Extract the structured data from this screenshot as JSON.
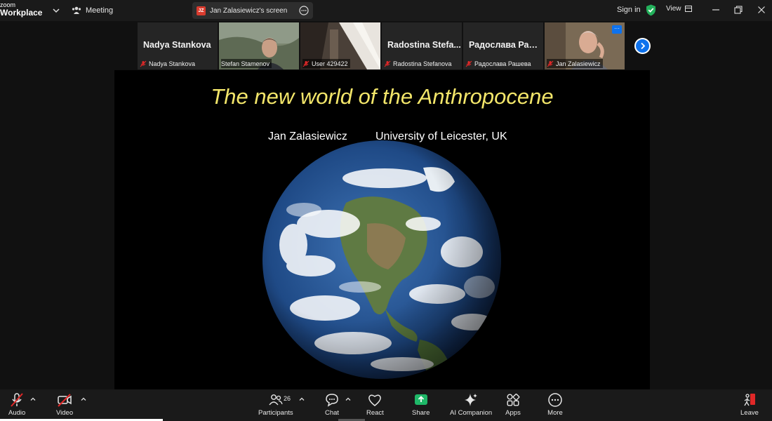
{
  "app": {
    "logo_line1": "zoom",
    "logo_line2": "Workplace",
    "meeting_label": "Meeting"
  },
  "share_pill": {
    "badge": "JZ",
    "label": "Jan Zalasiewicz's screen"
  },
  "top_right": {
    "sign_in": "Sign in",
    "view": "View"
  },
  "thumbnails": [
    {
      "big_name": "Nadya Stankova",
      "label": "Nadya Stankova",
      "muted": true,
      "video": false
    },
    {
      "big_name": "",
      "label": "Stefan Stamenov",
      "muted": false,
      "video": true,
      "active": true
    },
    {
      "big_name": "",
      "label": "User 429422",
      "muted": true,
      "video": true
    },
    {
      "big_name": "Radostina Stefa...",
      "label": "Radostina Stefanova",
      "muted": true,
      "video": false
    },
    {
      "big_name": "Радослава Раш...",
      "label": "Радослава Рашева",
      "muted": true,
      "video": false
    },
    {
      "big_name": "",
      "label": "Jan Zalasiewicz",
      "muted": true,
      "video": true
    }
  ],
  "slide": {
    "title": "The new world of the Anthropocene",
    "author": "Jan Zalasiewicz",
    "affiliation": "University of Leicester, UK"
  },
  "toolbar": {
    "audio": "Audio",
    "video": "Video",
    "participants": "Participants",
    "participants_count": "26",
    "chat": "Chat",
    "react": "React",
    "share": "Share",
    "ai_companion": "AI Companion",
    "apps": "Apps",
    "more": "More",
    "leave": "Leave"
  },
  "colors": {
    "accent": "#0e72ed",
    "share_green": "#1fb868",
    "active_border": "#2bbf7a",
    "mute_red": "#e02828",
    "title_yellow": "#f3e66a"
  }
}
